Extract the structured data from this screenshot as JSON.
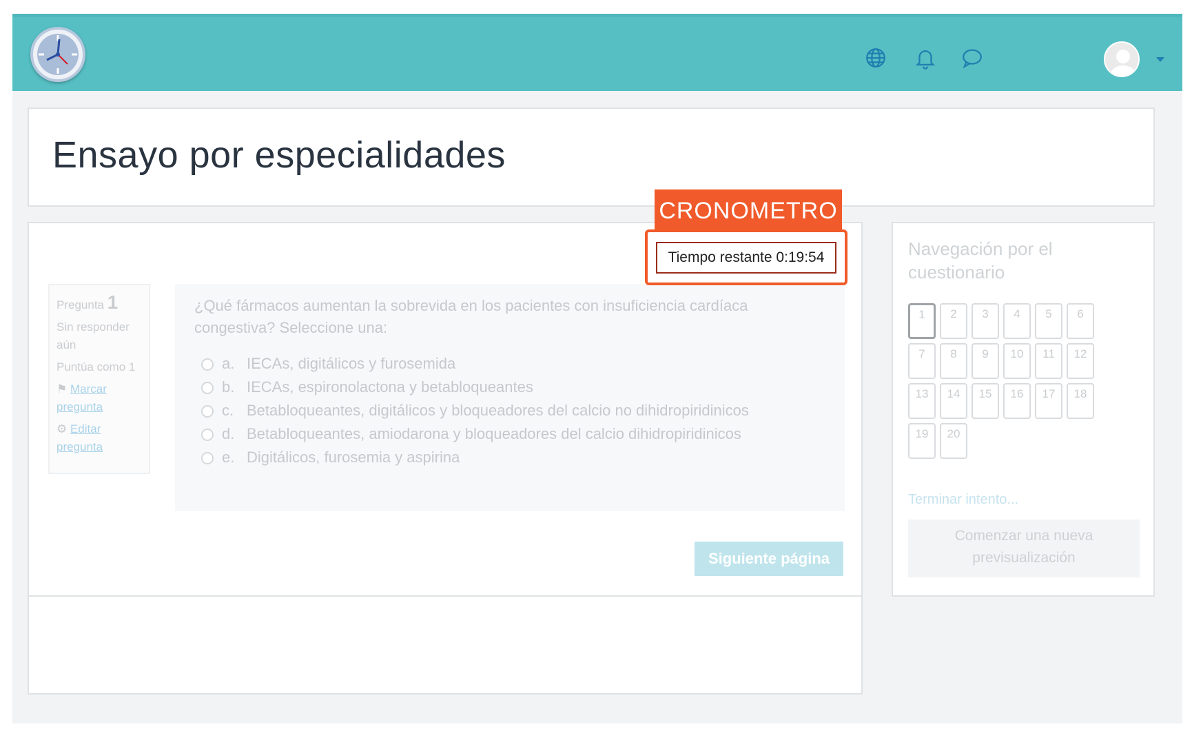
{
  "topbar": {
    "logo_icon": "clock-icon",
    "icons": [
      "globe-icon",
      "bell-icon",
      "chat-icon"
    ],
    "avatar_icon": "user-avatar",
    "brand_color": "#56bfc3"
  },
  "page": {
    "title": "Ensayo por especialidades"
  },
  "annotation": {
    "label": "CRONOMETRO",
    "color": "#f15a2b"
  },
  "timer": {
    "text": "Tiempo restante 0:19:54"
  },
  "question_info": {
    "label": "Pregunta",
    "number": "1",
    "status": "Sin responder aún",
    "score": "Puntúa como 1",
    "flag_link": "Marcar pregunta",
    "edit_link": "Editar pregunta"
  },
  "question": {
    "text": "¿Qué fármacos aumentan la sobrevida en los pacientes con insuficiencia cardíaca congestiva? Seleccione una:",
    "options": [
      {
        "letter": "a.",
        "text": "IECAs, digitálicos y furosemida"
      },
      {
        "letter": "b.",
        "text": "IECAs, espironolactona y betabloqueantes"
      },
      {
        "letter": "c.",
        "text": "Betabloqueantes, digitálicos y bloqueadores del calcio no dihidropiridinicos"
      },
      {
        "letter": "d.",
        "text": "Betabloqueantes, amiodarona y bloqueadores del calcio dihidropiridinicos"
      },
      {
        "letter": "e.",
        "text": "Digitálicos, furosemia y aspirina"
      }
    ]
  },
  "actions": {
    "next_label": "Siguiente página"
  },
  "sidebar": {
    "title": "Navegación por el cuestionario",
    "questions": [
      "1",
      "2",
      "3",
      "4",
      "5",
      "6",
      "7",
      "8",
      "9",
      "10",
      "11",
      "12",
      "13",
      "14",
      "15",
      "16",
      "17",
      "18",
      "19",
      "20"
    ],
    "finish_link": "Terminar intento...",
    "new_preview": "Comenzar una nueva previsualización"
  }
}
